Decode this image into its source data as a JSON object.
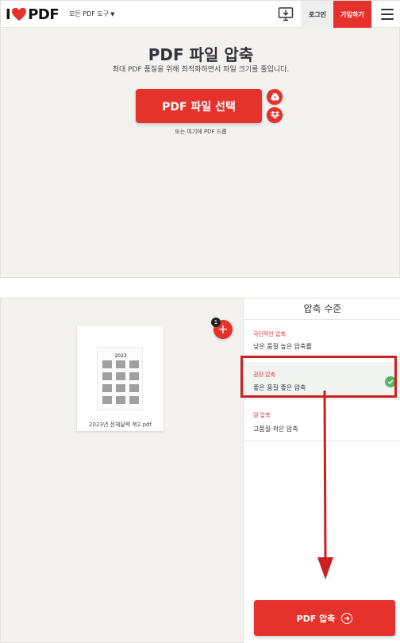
{
  "header": {
    "logo_text": "PDF",
    "tools_menu_label": "모든 PDF 도구",
    "login_label": "로그인",
    "signup_label": "가입하기"
  },
  "hero": {
    "title": "PDF 파일 압축",
    "subtitle": "최대 PDF 품질을 위해 최적화하면서 파일 크기를 줄입니다.",
    "select_button_label": "PDF 파일 선택",
    "drop_hint": "또는 여기에 PDF 드롭"
  },
  "workspace": {
    "file_count": "1",
    "file_name": "2023년 전체달력 복2.pdf",
    "thumbnail_year": "2023"
  },
  "sidebar": {
    "title": "압축 수준",
    "levels": [
      {
        "title": "극단적인 압축",
        "description": "낮은 품질 높은 압축률"
      },
      {
        "title": "권장 압축",
        "description": "좋은 품질 좋은 압축",
        "selected": true
      },
      {
        "title": "덜 압축",
        "description": "고품질 적은 압축"
      }
    ],
    "compress_button_label": "PDF 압축"
  },
  "colors": {
    "brand_red": "#e5322d",
    "annotation_red": "#cc1f1f",
    "selected_green": "#55b466",
    "background": "#f4f2ef"
  },
  "icons": {
    "logo": "heart-icon",
    "desktop": "desktop-download-icon",
    "menu": "hamburger-icon",
    "google_drive": "google-drive-icon",
    "dropbox": "dropbox-icon",
    "add": "plus-icon",
    "check": "check-icon",
    "go": "arrow-right-circle-icon"
  }
}
